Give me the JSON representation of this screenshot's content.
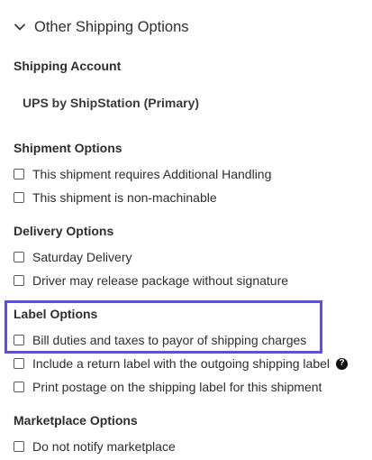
{
  "header": {
    "title": "Other Shipping Options",
    "chevron_icon": "chevron-down-icon"
  },
  "shipping_account": {
    "label": "Shipping Account",
    "value": "UPS by ShipStation (Primary)"
  },
  "shipment_options": {
    "label": "Shipment Options",
    "items": [
      {
        "label": "This shipment requires Additional Handling",
        "checked": false
      },
      {
        "label": "This shipment is non-machinable",
        "checked": false
      }
    ]
  },
  "delivery_options": {
    "label": "Delivery Options",
    "items": [
      {
        "label": "Saturday Delivery",
        "checked": false
      },
      {
        "label": "Driver may release package without signature",
        "checked": false
      }
    ]
  },
  "label_options": {
    "label": "Label Options",
    "items": [
      {
        "label": "Bill duties and taxes to payor of shipping charges",
        "checked": false
      },
      {
        "label": "Include a return label with the outgoing shipping label",
        "checked": false,
        "help_icon": "question-circle-icon",
        "help_glyph": "?"
      },
      {
        "label": "Print postage on the shipping label for this shipment",
        "checked": false
      }
    ]
  },
  "marketplace_options": {
    "label": "Marketplace Options",
    "items": [
      {
        "label": "Do not notify marketplace",
        "checked": false
      }
    ]
  },
  "colors": {
    "highlight": "#5b4ee6",
    "text": "#2e2e2e"
  }
}
